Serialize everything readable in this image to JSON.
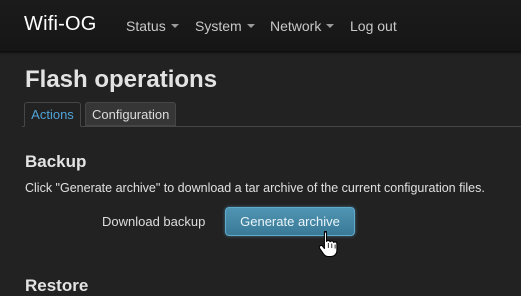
{
  "navbar": {
    "brand": "Wifi-OG",
    "items": [
      {
        "label": "Status",
        "has_dropdown": true
      },
      {
        "label": "System",
        "has_dropdown": true
      },
      {
        "label": "Network",
        "has_dropdown": true
      },
      {
        "label": "Log out",
        "has_dropdown": false
      }
    ]
  },
  "page": {
    "title": "Flash operations"
  },
  "tabs": [
    {
      "label": "Actions",
      "active": true
    },
    {
      "label": "Configuration",
      "active": false
    }
  ],
  "backup": {
    "heading": "Backup",
    "description": "Click \"Generate archive\" to download a tar archive of the current configuration files.",
    "field_label": "Download backup",
    "button_label": "Generate archive"
  },
  "next_section": {
    "heading": "Restore"
  },
  "colors": {
    "background": "#222222",
    "navbar": "#181818",
    "accent": "#4fa3d8",
    "button": "#3f86a6"
  },
  "icons": {
    "cursor": "hand-pointer-icon",
    "dropdown": "caret-down-icon"
  }
}
